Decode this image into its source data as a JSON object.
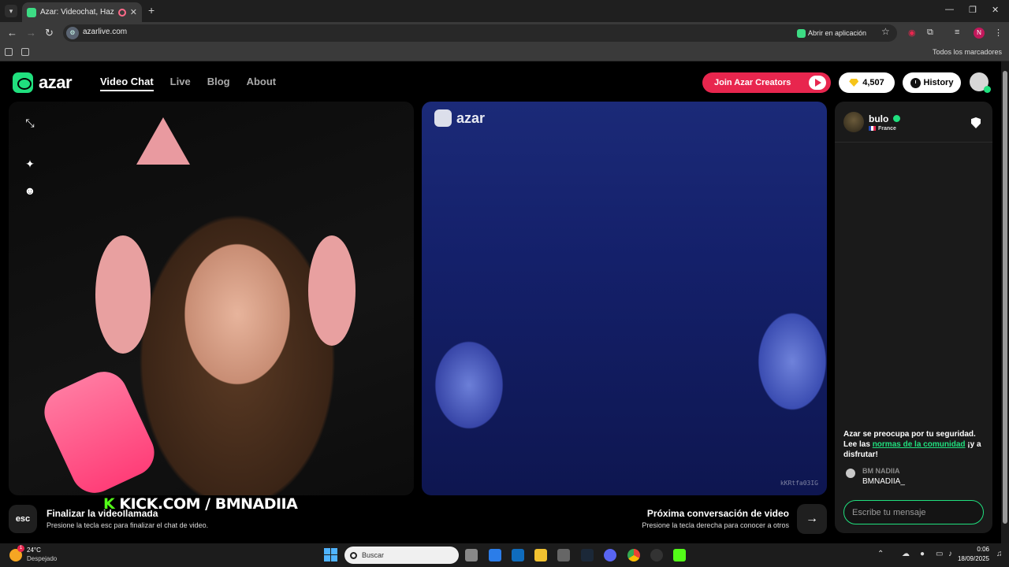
{
  "browser": {
    "tab_title": "Azar: Videochat, Haz nuevo",
    "close_glyph": "✕",
    "new_tab_glyph": "+",
    "url": "azarlive.com",
    "open_in_app": "Abrir en aplicación",
    "all_bookmarks": "Todos los marcadores",
    "profile_initial": "N",
    "extension_badge": "2"
  },
  "nav": {
    "logo": "azar",
    "items": [
      "Video Chat",
      "Live",
      "Blog",
      "About"
    ],
    "active": "Video Chat"
  },
  "header": {
    "creators_button": "Join Azar Creators",
    "gems": "4,507",
    "history": "History"
  },
  "video": {
    "overlay_text": "KICK.COM / BMNADIIA",
    "overlay_letter": "K",
    "partner_logo": "azar",
    "watermark": "kKRtfa03IG"
  },
  "controls": {
    "esc_label": "esc",
    "end_title": "Finalizar la videollamada",
    "end_hint": "Presione la tecla esc para finalizar el chat de video.",
    "next_title": "Próxima conversación de video",
    "next_hint": "Presione la tecla derecha para conocer a otros"
  },
  "chat": {
    "partner_name": "bulo",
    "partner_country": "France",
    "safety_prefix": "Azar se preocupa por tu seguridad. Lee las ",
    "safety_link": "normas de la comunidad",
    "safety_suffix": " ¡y a disfrutar!",
    "message_sender": "BM NADIIA",
    "message_text": "BMNADIIA_",
    "input_placeholder": "Escribe tu mensaje"
  },
  "taskbar": {
    "temperature": "24°C",
    "condition": "Despejado",
    "weather_badge": "1",
    "search_placeholder": "Buscar",
    "time": "0:06",
    "date": "18/09/2025"
  },
  "colors": {
    "brand_green": "#20e07e",
    "creators_red": "#e8264e",
    "kick_green": "#53fc18"
  }
}
